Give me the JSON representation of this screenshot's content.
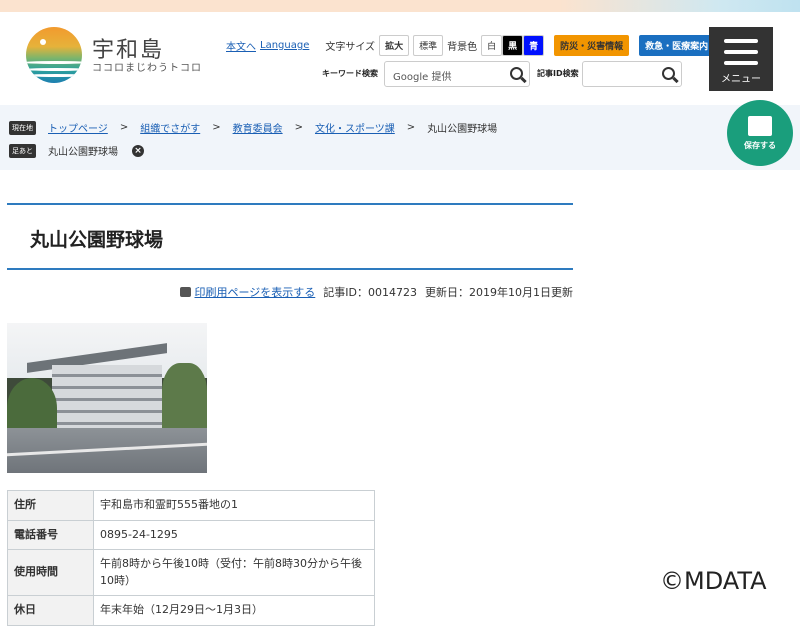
{
  "header": {
    "site_name": "宇和島",
    "tagline": "ココロまじわうトコロ",
    "skip_link": "本文へ",
    "language_link": "Language",
    "font_size_label": "文字サイズ",
    "font_larger": "拡大",
    "font_standard": "標準",
    "bg_label": "背景色",
    "bg_white": "白",
    "bg_black": "黒",
    "bg_blue": "青",
    "disaster_button": "防災・災害情報",
    "emergency_button": "救急・医療案内",
    "keyword_label": "キーワード検索",
    "keyword_placeholder": "Google 提供",
    "article_id_label": "記事ID検索",
    "menu_label": "メニュー"
  },
  "breadcrumb": {
    "current_tag": "現在地",
    "items": [
      "トップページ",
      "組織でさがす",
      "教育委員会",
      "文化・スポーツ課"
    ],
    "current": "丸山公園野球場",
    "separator": ">",
    "history_tag": "足あと",
    "history_item": "丸山公園野球場"
  },
  "save_button": "保存する",
  "page": {
    "title": "丸山公園野球場",
    "print_link": "印刷用ページを表示する",
    "article_id": "記事ID：0014723",
    "updated": "更新日：2019年10月1日更新"
  },
  "info_table": [
    {
      "label": "住所",
      "value": "宇和島市和霊町555番地の1"
    },
    {
      "label": "電話番号",
      "value": "0895-24-1295"
    },
    {
      "label": "使用時間",
      "value": "午前8時から午後10時（受付：午前8時30分から午後10時）"
    },
    {
      "label": "休日",
      "value": "年末年始（12月29日～1月3日）"
    }
  ],
  "watermark": "©MDATA",
  "colors": {
    "accent": "#2e7bbf",
    "save": "#1a9e7c",
    "disaster": "#f29500",
    "emergency": "#1a6fc0"
  }
}
